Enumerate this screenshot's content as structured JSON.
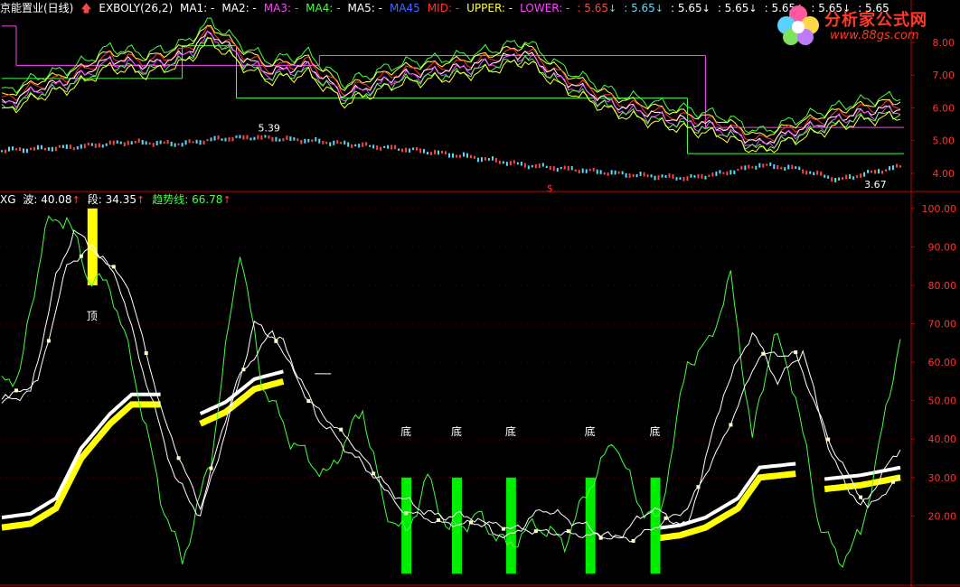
{
  "top_header": {
    "title": "京能置业(日线)",
    "indicator": "EXBOLY(26,2)",
    "items": [
      {
        "label": "MA1: -",
        "color": "#ffffff"
      },
      {
        "label": "MA2: -",
        "color": "#ffffff"
      },
      {
        "label": "MA3: -",
        "color": "#ff44ff"
      },
      {
        "label": "MA4: -",
        "color": "#44ff44"
      },
      {
        "label": "MA5: -",
        "color": "#ffffff"
      },
      {
        "label": "MA45",
        "color": "#4466ff"
      },
      {
        "label": "MID: -",
        "color": "#ff3333"
      },
      {
        "label": "UPPER: -",
        "color": "#ffff44"
      },
      {
        "label": "LOWER: -",
        "color": "#ff44ff"
      },
      {
        "label": ": 5.65",
        "color": "#ff4444",
        "arrow": "↓",
        "arrow_color": "#55ddff"
      },
      {
        "label": ": 5.65",
        "color": "#55ddff",
        "arrow": "↓",
        "arrow_color": "#55ddff"
      },
      {
        "label": ": 5.65",
        "color": "#ffffff",
        "arrow": "↓",
        "arrow_color": "#ffffff"
      },
      {
        "label": ": 5.65",
        "color": "#ffffff",
        "arrow": "↓",
        "arrow_color": "#ffffff"
      },
      {
        "label": ": 5.65",
        "color": "#ffffff",
        "arrow": "↓",
        "arrow_color": "#ffffff"
      },
      {
        "label": ": 5.65",
        "color": "#ffffff",
        "arrow": "↓",
        "arrow_color": "#ffffff"
      },
      {
        "label": ": 5.65",
        "color": "#ffffff",
        "arrow": "",
        "arrow_color": "#ffffff"
      }
    ]
  },
  "logo": {
    "brand": "分析家公式网",
    "url": "www.88gs.com"
  },
  "bottom_header": {
    "name": "XG",
    "items": [
      {
        "label": "波: 40.08",
        "color": "#ffffff",
        "arrow": "↑",
        "arrow_color": "#ff4444"
      },
      {
        "label": "段: 34.35",
        "color": "#ffffff",
        "arrow": "↑",
        "arrow_color": "#ff4444"
      },
      {
        "label": "趋势线: 66.78",
        "color": "#44ff44",
        "arrow": "↑",
        "arrow_color": "#ff4444"
      }
    ]
  },
  "colors": {
    "background": "#000000",
    "frame": "#bb0000",
    "axis_text": "#ff3333",
    "upper": "#ffff44",
    "lower": "#ff44ff",
    "mid": "#ff3333",
    "ma_green": "#44ff44",
    "ma_white": "#ffffff",
    "bar_yellow": "#ffff00",
    "bar_green": "#00ee00",
    "candle_up": "#ff4444",
    "candle_down": "#55ddff"
  },
  "chart_data": [
    {
      "type": "line",
      "panel": "price",
      "yticks": [
        4.0,
        5.0,
        6.0,
        7.0,
        8.0
      ],
      "ylim": [
        3.5,
        8.8
      ],
      "annotations": [
        {
          "text": "5.39",
          "x": 70,
          "y": 5.39
        },
        {
          "text": "3.67",
          "x": 238,
          "y": 3.67
        },
        {
          "text": "$",
          "x": 150,
          "y": 3.55
        }
      ],
      "x_count": 250,
      "step_levels_magenta": [
        {
          "x0": 0,
          "x1": 4,
          "y": 8.5
        },
        {
          "x0": 4,
          "x1": 88,
          "y": 7.3
        },
        {
          "x0": 88,
          "x1": 195,
          "y": 7.6
        },
        {
          "x0": 195,
          "x1": 250,
          "y": 5.4
        }
      ],
      "step_levels_green": [
        {
          "x0": 0,
          "x1": 50,
          "y": 6.9
        },
        {
          "x0": 50,
          "x1": 65,
          "y": 7.9
        },
        {
          "x0": 65,
          "x1": 190,
          "y": 6.3
        },
        {
          "x0": 190,
          "x1": 250,
          "y": 4.6
        }
      ],
      "close_knots": [
        [
          0,
          6.1
        ],
        [
          10,
          6.6
        ],
        [
          20,
          6.9
        ],
        [
          30,
          7.5
        ],
        [
          40,
          7.3
        ],
        [
          50,
          7.6
        ],
        [
          58,
          8.3
        ],
        [
          66,
          7.6
        ],
        [
          74,
          7.1
        ],
        [
          85,
          7.3
        ],
        [
          95,
          6.4
        ],
        [
          110,
          7.0
        ],
        [
          125,
          7.2
        ],
        [
          135,
          7.4
        ],
        [
          145,
          7.7
        ],
        [
          155,
          6.9
        ],
        [
          170,
          6.1
        ],
        [
          185,
          5.7
        ],
        [
          200,
          5.4
        ],
        [
          210,
          4.9
        ],
        [
          220,
          5.3
        ],
        [
          232,
          5.7
        ],
        [
          240,
          5.9
        ],
        [
          249,
          6.0
        ]
      ],
      "candle_knots": [
        [
          0,
          4.7
        ],
        [
          20,
          4.8
        ],
        [
          35,
          4.95
        ],
        [
          50,
          4.9
        ],
        [
          60,
          5.05
        ],
        [
          70,
          5.1
        ],
        [
          85,
          5.0
        ],
        [
          100,
          4.85
        ],
        [
          115,
          4.7
        ],
        [
          130,
          4.5
        ],
        [
          145,
          4.25
        ],
        [
          160,
          4.1
        ],
        [
          175,
          3.95
        ],
        [
          190,
          3.85
        ],
        [
          200,
          4.0
        ],
        [
          210,
          4.25
        ],
        [
          220,
          4.15
        ],
        [
          232,
          3.8
        ],
        [
          240,
          4.0
        ],
        [
          249,
          4.2
        ]
      ]
    },
    {
      "type": "line",
      "panel": "indicator",
      "yticks": [
        20.0,
        30.0,
        40.0,
        50.0,
        60.0,
        70.0,
        80.0,
        90.0,
        100.0
      ],
      "ylim": [
        2,
        103
      ],
      "x_count": 250,
      "series": [
        {
          "name": "波",
          "values_knots": [
            [
              0,
              50
            ],
            [
              8,
              52
            ],
            [
              15,
              82
            ],
            [
              20,
              94
            ],
            [
              25,
              90
            ],
            [
              32,
              82
            ],
            [
              40,
              55
            ],
            [
              48,
              30
            ],
            [
              55,
              20
            ],
            [
              62,
              42
            ],
            [
              70,
              70
            ],
            [
              78,
              65
            ],
            [
              88,
              45
            ],
            [
              98,
              35
            ],
            [
              110,
              25
            ],
            [
              120,
              20
            ],
            [
              130,
              20
            ],
            [
              140,
              14
            ],
            [
              150,
              22
            ],
            [
              160,
              18
            ],
            [
              170,
              14
            ],
            [
              180,
              22
            ],
            [
              190,
              17
            ],
            [
              200,
              52
            ],
            [
              208,
              68
            ],
            [
              215,
              55
            ],
            [
              222,
              63
            ],
            [
              230,
              35
            ],
            [
              238,
              22
            ],
            [
              249,
              38
            ]
          ]
        },
        {
          "name": "段",
          "values_knots": [
            [
              0,
              50
            ],
            [
              10,
              55
            ],
            [
              18,
              85
            ],
            [
              25,
              90
            ],
            [
              35,
              80
            ],
            [
              45,
              45
            ],
            [
              55,
              22
            ],
            [
              65,
              55
            ],
            [
              75,
              68
            ],
            [
              85,
              50
            ],
            [
              98,
              38
            ],
            [
              110,
              22
            ],
            [
              122,
              18
            ],
            [
              135,
              18
            ],
            [
              148,
              16
            ],
            [
              162,
              15
            ],
            [
              175,
              14
            ],
            [
              190,
              22
            ],
            [
              200,
              40
            ],
            [
              210,
              62
            ],
            [
              220,
              62
            ],
            [
              230,
              38
            ],
            [
              240,
              22
            ],
            [
              249,
              30
            ]
          ]
        },
        {
          "name": "趋势线",
          "values_knots": [
            [
              0,
              55
            ],
            [
              5,
              57
            ],
            [
              12,
              95
            ],
            [
              18,
              98
            ],
            [
              24,
              82
            ],
            [
              30,
              80
            ],
            [
              36,
              60
            ],
            [
              44,
              25
            ],
            [
              50,
              8
            ],
            [
              58,
              35
            ],
            [
              66,
              90
            ],
            [
              72,
              55
            ],
            [
              80,
              40
            ],
            [
              90,
              30
            ],
            [
              100,
              48
            ],
            [
              106,
              22
            ],
            [
              112,
              15
            ],
            [
              118,
              30
            ],
            [
              124,
              16
            ],
            [
              132,
              20
            ],
            [
              140,
              12
            ],
            [
              148,
              18
            ],
            [
              156,
              13
            ],
            [
              164,
              30
            ],
            [
              170,
              40
            ],
            [
              176,
              24
            ],
            [
              182,
              18
            ],
            [
              190,
              60
            ],
            [
              196,
              65
            ],
            [
              202,
              82
            ],
            [
              208,
              40
            ],
            [
              214,
              68
            ],
            [
              220,
              52
            ],
            [
              226,
              20
            ],
            [
              232,
              8
            ],
            [
              238,
              15
            ],
            [
              244,
              42
            ],
            [
              249,
              67
            ]
          ]
        },
        {
          "name": "yellow_trend",
          "values_knots": [
            [
              0,
              17
            ],
            [
              8,
              18
            ],
            [
              15,
              22
            ],
            [
              22,
              35
            ],
            [
              30,
              44
            ],
            [
              36,
              49
            ],
            [
              44,
              49
            ],
            null,
            [
              55,
              44
            ],
            [
              62,
              47
            ],
            [
              70,
              53
            ],
            [
              78,
              55
            ],
            null,
            [
              180,
              14
            ],
            [
              188,
              15
            ],
            [
              195,
              17
            ],
            [
              204,
              22
            ],
            [
              210,
              30
            ],
            [
              220,
              31
            ],
            null,
            [
              228,
              27
            ],
            [
              238,
              28
            ],
            [
              249,
              30
            ]
          ]
        }
      ],
      "bars_yellow": [
        {
          "x": 25,
          "y0": 80,
          "y1": 100
        }
      ],
      "bars_green": [
        {
          "x": 112,
          "y0": 5,
          "y1": 30
        },
        {
          "x": 126,
          "y0": 5,
          "y1": 30
        },
        {
          "x": 141,
          "y0": 5,
          "y1": 30
        },
        {
          "x": 163,
          "y0": 5,
          "y1": 30
        },
        {
          "x": 181,
          "y0": 5,
          "y1": 30
        }
      ],
      "labels_top": [
        {
          "text": "顶",
          "x": 25,
          "y": 71
        }
      ],
      "labels_bottom": [
        {
          "text": "底",
          "x": 112,
          "y": 41
        },
        {
          "text": "底",
          "x": 126,
          "y": 41
        },
        {
          "text": "底",
          "x": 141,
          "y": 41
        },
        {
          "text": "底",
          "x": 163,
          "y": 41
        },
        {
          "text": "底",
          "x": 181,
          "y": 41
        }
      ],
      "dash_marks": [
        {
          "x": 89,
          "y": 57
        }
      ]
    }
  ]
}
